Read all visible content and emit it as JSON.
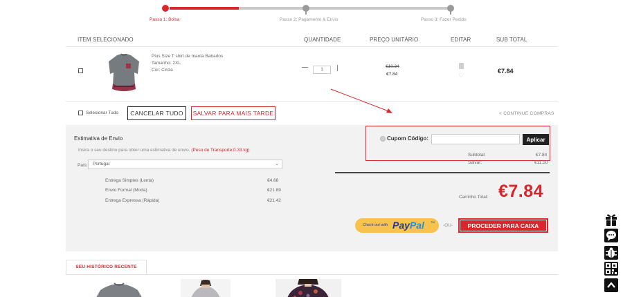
{
  "steps": [
    {
      "label": "Passo 1: Bolsa",
      "active": true
    },
    {
      "label": "Passo 2: Pagamento & Envio",
      "active": false
    },
    {
      "label": "Passo 3: Fazer Pedido",
      "active": false
    }
  ],
  "table": {
    "headers": [
      "ITEM SELECIONADO",
      "QUANTIDADE",
      "PREÇO UNITÁRIO",
      "EDITAR",
      "SUB TOTAL"
    ]
  },
  "item": {
    "name": "Plus Size T shirt de manta Babados",
    "size": "Tamanho: 2XL",
    "color": "Cor: Cinza",
    "quantity": "1",
    "price_old": "€10.34",
    "price_new": "€7.84",
    "subtotal": "€7.84"
  },
  "actions": {
    "select_all": "Selecionar Tudo",
    "cancel_all": "CANCELAR TUDO",
    "save_later": "SALVAR PARA MAIS TARDE",
    "continue": "< CONTINUE COMPRAS"
  },
  "shipping": {
    "title": "Estimativa de Envio",
    "desc": "Insira o seu destino para obter uma estimativa de envio.",
    "weight": "(Peso de Transporte:0.33 kg)",
    "country_label": "País:",
    "country_value": "Portugal",
    "options": [
      {
        "name": "Entrega Simples (Lenta)",
        "price": "€4.68"
      },
      {
        "name": "Envio Formal (Moda)",
        "price": "€21.89"
      },
      {
        "name": "Entrega Expressa (Rápida)",
        "price": "€21.42"
      }
    ]
  },
  "coupon": {
    "label": "Cupom Código:",
    "value": "",
    "apply": "Aplicar"
  },
  "summary": {
    "subtotal_label": "Subtotal:",
    "subtotal_value": "€7.84",
    "saved_label": "Salvar:",
    "saved_value": "€11.50",
    "total_label": "Carrinho Total:",
    "total_value": "€7.84"
  },
  "paypal": {
    "small": "Check out with",
    "brand_a": "Pay",
    "brand_b": "Pal",
    "tm": "TM"
  },
  "or_label": "-OU-",
  "checkout": "PROCEDER PARA CAIXA",
  "history_tab": "SEU HISTÓRICO RECENTE",
  "colors": {
    "accent": "#d8262e",
    "panel": "#f2f2f2",
    "paypal_yellow": "#f7c24d",
    "paypal_blue": "#1d3e80"
  },
  "side_icons": [
    "gift-icon",
    "chat-icon",
    "bug-icon",
    "qr-code-icon",
    "arrow-up-icon"
  ]
}
